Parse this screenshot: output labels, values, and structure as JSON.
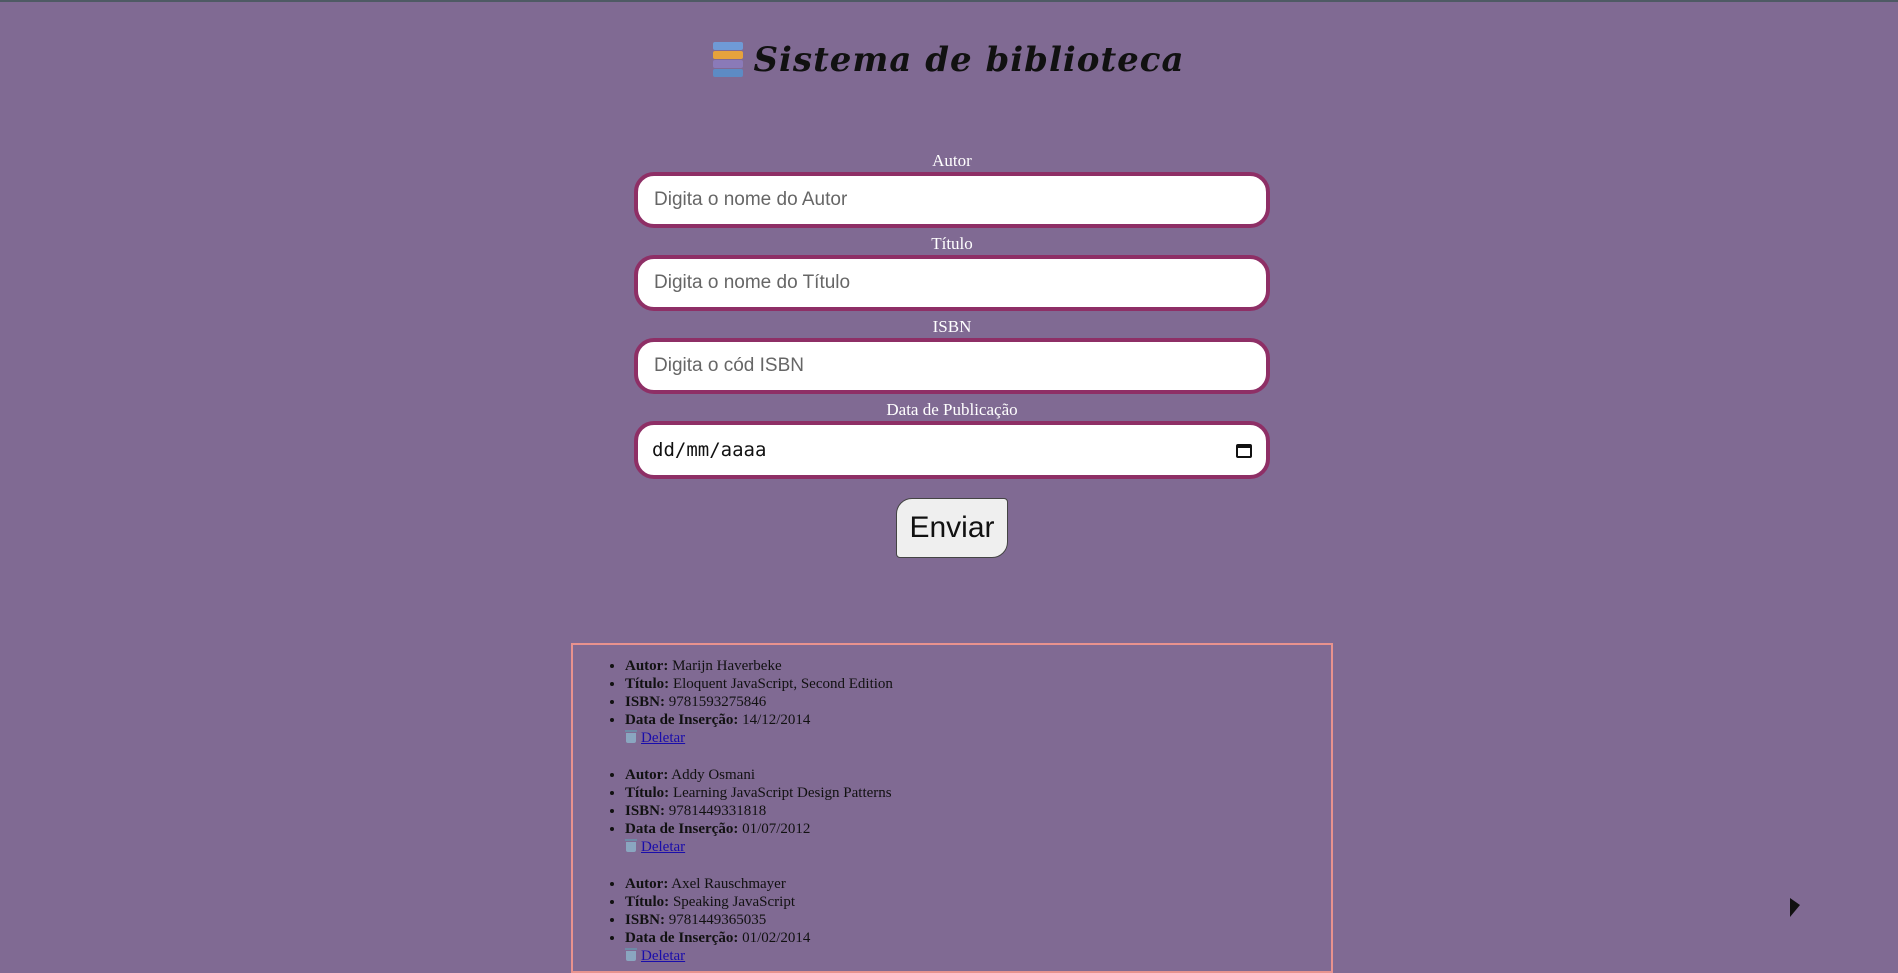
{
  "header": {
    "title": "Sistema de biblioteca",
    "icon": "books-icon"
  },
  "form": {
    "author": {
      "label": "Autor",
      "placeholder": "Digita o nome do Autor",
      "value": ""
    },
    "title": {
      "label": "Título",
      "placeholder": "Digita o nome do Título",
      "value": ""
    },
    "isbn": {
      "label": "ISBN",
      "placeholder": "Digita o cód ISBN",
      "value": ""
    },
    "date": {
      "label": "Data de Publicação",
      "display": "dd/mm/aaaa"
    },
    "submit_label": "Enviar"
  },
  "labels": {
    "author": "Autor:",
    "title": "Título:",
    "isbn": "ISBN:",
    "inserted": "Data de Inserção:",
    "delete": "Deletar"
  },
  "books": [
    {
      "author": "Marijn Haverbeke",
      "title": "Eloquent JavaScript, Second Edition",
      "isbn": "9781593275846",
      "date": "14/12/2014"
    },
    {
      "author": "Addy Osmani",
      "title": "Learning JavaScript Design Patterns",
      "isbn": "9781449331818",
      "date": "01/07/2012"
    },
    {
      "author": "Axel Rauschmayer",
      "title": "Speaking JavaScript",
      "isbn": "9781449365035",
      "date": "01/02/2014"
    }
  ],
  "colors": {
    "background": "#806a93",
    "input_border": "#8e2f66",
    "list_border": "#e8928e",
    "link": "#1a0dab"
  }
}
